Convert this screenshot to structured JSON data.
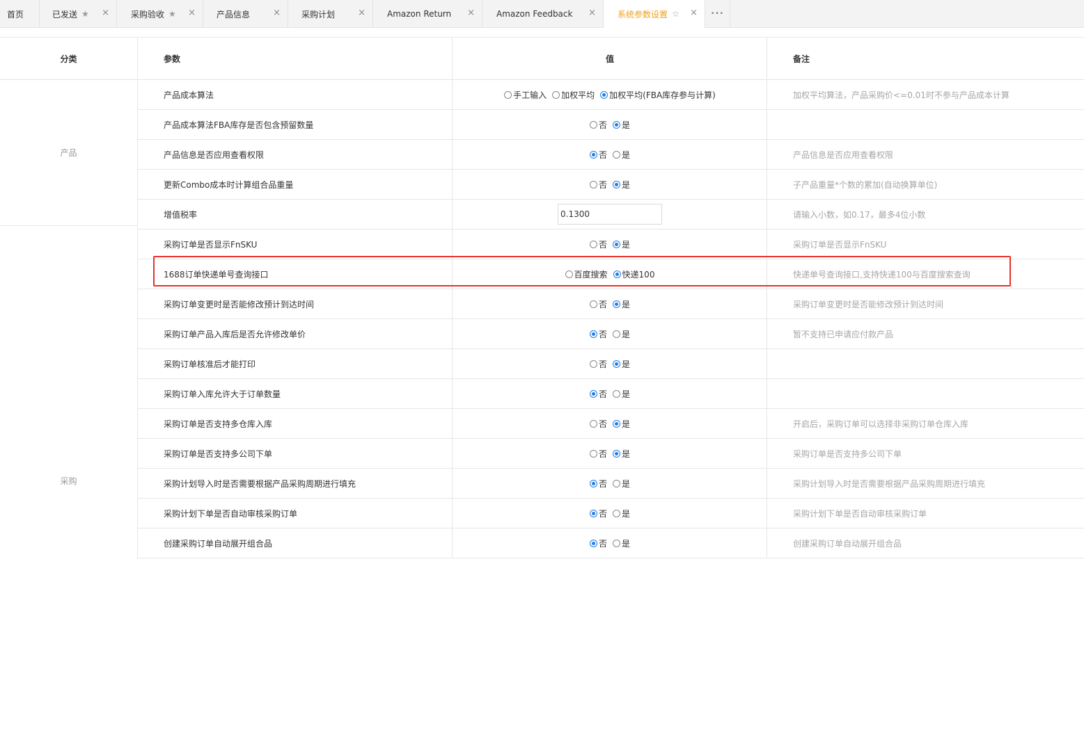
{
  "tabs": [
    {
      "label": "首页",
      "star": false,
      "close": false,
      "active": false
    },
    {
      "label": "已发送",
      "star": true,
      "close": true,
      "active": false
    },
    {
      "label": "采购验收",
      "star": true,
      "close": true,
      "active": false
    },
    {
      "label": "产品信息",
      "star": false,
      "close": true,
      "active": false
    },
    {
      "label": "采购计划",
      "star": false,
      "close": true,
      "active": false
    },
    {
      "label": "Amazon Return",
      "star": false,
      "close": true,
      "active": false
    },
    {
      "label": "Amazon Feedback",
      "star": false,
      "close": true,
      "active": false
    },
    {
      "label": "系统参数设置",
      "star": true,
      "close": true,
      "active": true
    }
  ],
  "icons": {
    "star_filled": "★",
    "star_outline": "☆",
    "close": "×",
    "more": "•••"
  },
  "colors": {
    "active_tab": "#f0a118",
    "radio_selected": "#1f7de6",
    "highlight_border": "#e8302a",
    "note_text": "#a6a6a6"
  },
  "table": {
    "headers": {
      "category": "分类",
      "param": "参数",
      "value": "值",
      "note": "备注"
    },
    "categories": {
      "product": "产品",
      "purchase": "采购"
    },
    "rows": [
      {
        "param": "产品成本算法",
        "type": "radio",
        "options": [
          "手工输入",
          "加权平均",
          "加权平均(FBA库存参与计算)"
        ],
        "selected": 2,
        "note": "加权平均算法，产品采购价<=0.01时不参与产品成本计算"
      },
      {
        "param": "产品成本算法FBA库存是否包含预留数量",
        "type": "radio",
        "options": [
          "否",
          "是"
        ],
        "selected": 1,
        "note": ""
      },
      {
        "param": "产品信息是否应用查看权限",
        "type": "radio",
        "options": [
          "否",
          "是"
        ],
        "selected": 0,
        "note": "产品信息是否应用查看权限"
      },
      {
        "param": "更新Combo成本时计算组合品重量",
        "type": "radio",
        "options": [
          "否",
          "是"
        ],
        "selected": 1,
        "note": "子产品重量*个数的累加(自动换算单位)"
      },
      {
        "param": "增值税率",
        "type": "input",
        "value": "0.1300",
        "note": "请输入小数，如0.17，最多4位小数"
      },
      {
        "param": "采购订单是否显示FnSKU",
        "type": "radio",
        "options": [
          "否",
          "是"
        ],
        "selected": 1,
        "note": "采购订单是否显示FnSKU"
      },
      {
        "param": "1688订单快递单号查询接口",
        "type": "radio",
        "options": [
          "百度搜索",
          "快递100"
        ],
        "selected": 1,
        "note": "快递单号查询接口,支持快递100与百度搜索查询"
      },
      {
        "param": "采购订单变更时是否能修改预计到达时间",
        "type": "radio",
        "options": [
          "否",
          "是"
        ],
        "selected": 1,
        "note": "采购订单变更时是否能修改预计到达时间"
      },
      {
        "param": "采购订单产品入库后是否允许修改单价",
        "type": "radio",
        "options": [
          "否",
          "是"
        ],
        "selected": 0,
        "note": "暂不支持已申请应付款产品"
      },
      {
        "param": "采购订单核准后才能打印",
        "type": "radio",
        "options": [
          "否",
          "是"
        ],
        "selected": 1,
        "note": ""
      },
      {
        "param": "采购订单入库允许大于订单数量",
        "type": "radio",
        "options": [
          "否",
          "是"
        ],
        "selected": 0,
        "note": ""
      },
      {
        "param": "采购订单是否支持多仓库入库",
        "type": "radio",
        "options": [
          "否",
          "是"
        ],
        "selected": 1,
        "note": "开启后，采购订单可以选择非采购订单仓库入库"
      },
      {
        "param": "采购订单是否支持多公司下单",
        "type": "radio",
        "options": [
          "否",
          "是"
        ],
        "selected": 1,
        "note": "采购订单是否支持多公司下单"
      },
      {
        "param": "采购计划导入时是否需要根据产品采购周期进行填充",
        "type": "radio",
        "options": [
          "否",
          "是"
        ],
        "selected": 0,
        "note": "采购计划导入时是否需要根据产品采购周期进行填充"
      },
      {
        "param": "采购计划下单是否自动审核采购订单",
        "type": "radio",
        "options": [
          "否",
          "是"
        ],
        "selected": 0,
        "note": "采购计划下单是否自动审核采购订单"
      },
      {
        "param": "创建采购订单自动展开组合品",
        "type": "radio",
        "options": [
          "否",
          "是"
        ],
        "selected": 0,
        "note": "创建采购订单自动展开组合品"
      }
    ]
  }
}
